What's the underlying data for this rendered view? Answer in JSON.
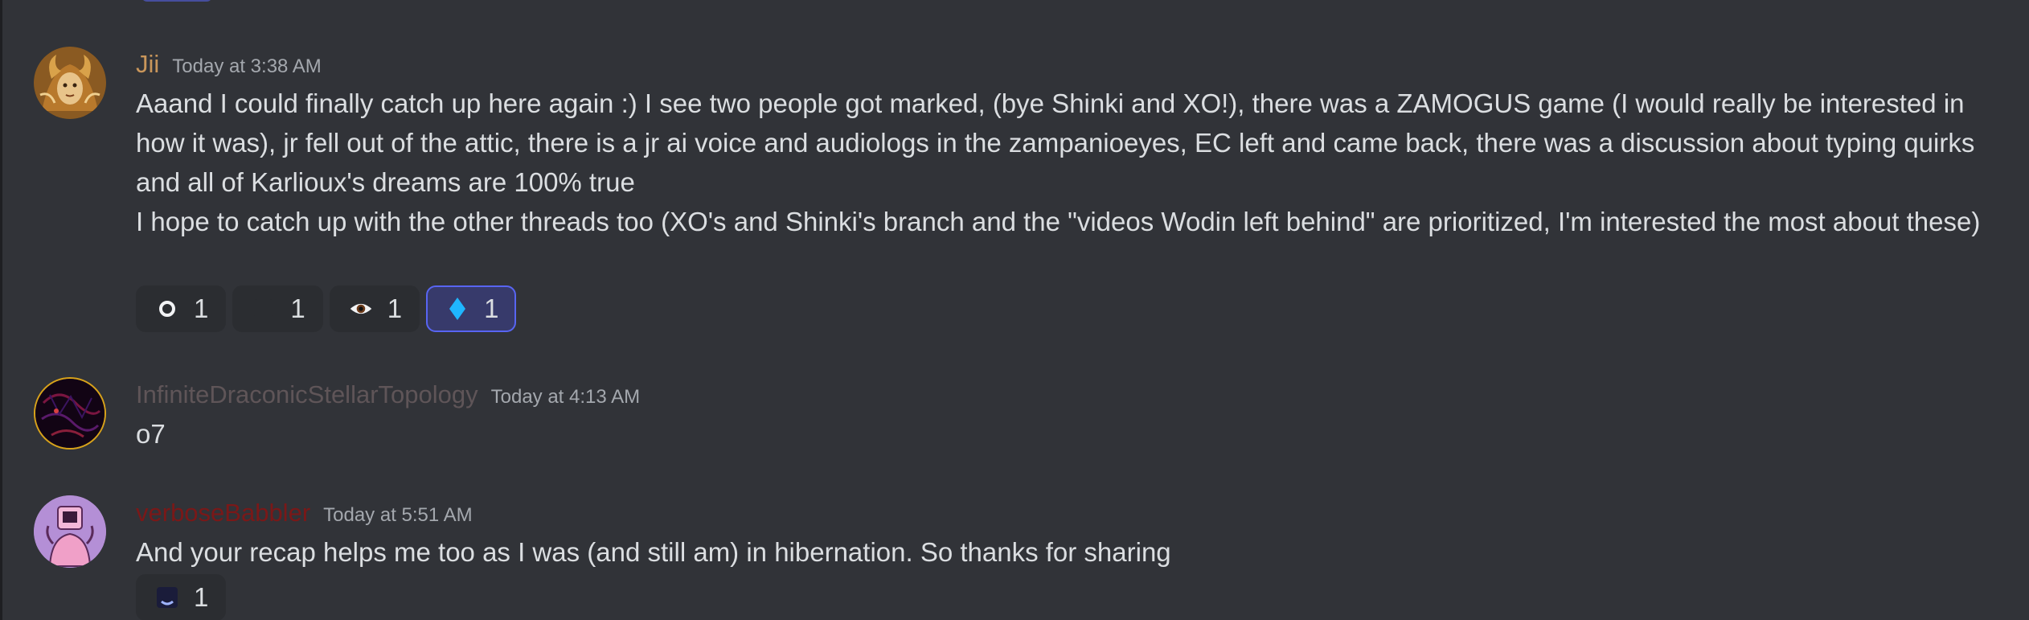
{
  "messages": [
    {
      "author": "Jii",
      "author_color": "#c9965b",
      "timestamp": "Today at 3:38 AM",
      "lines": [
        "Aaand I could finally catch up here again :) I see two people got marked, (bye Shinki and XO!), there was a ZAMOGUS game (I would really be interested in how it was), jr fell out of the attic, there is a jr ai voice and audiologs in the zampanioeyes, EC left and came back, there was a discussion about typing quirks and all of Karlioux's dreams are 100% true",
        "I hope to catch up with the other threads too (XO's and Shinki's branch and the \"videos Wodin left behind\" are prioritized, I'm interested the most about these)"
      ],
      "reactions": [
        {
          "icon": "ring-emoji-icon",
          "count": "1",
          "active": false
        },
        {
          "icon": "dark-emoji-icon",
          "count": "1",
          "active": false
        },
        {
          "icon": "eye-emoji-icon",
          "count": "1",
          "active": false
        },
        {
          "icon": "diamond-emoji-icon",
          "count": "1",
          "active": true
        }
      ]
    },
    {
      "author": "InfiniteDraconicStellarTopology",
      "author_color": "#5f5558",
      "timestamp": "Today at 4:13 AM",
      "lines": [
        "o7"
      ],
      "reactions": []
    },
    {
      "author": "verboseBabbler",
      "author_color": "#7a1818",
      "timestamp": "Today at 5:51 AM",
      "lines": [
        "And your recap helps me too as I was (and still am) in hibernation. So thanks for sharing"
      ],
      "reactions": [
        {
          "icon": "moon-emoji-icon",
          "count": "1",
          "active": false
        }
      ]
    }
  ],
  "colors": {
    "background": "#313338",
    "reaction_bg": "#2b2d31",
    "reaction_active_bg": "#373a6b",
    "reaction_active_border": "#5865f2",
    "timestamp": "#a4a8ae",
    "text": "#dbdee1"
  }
}
